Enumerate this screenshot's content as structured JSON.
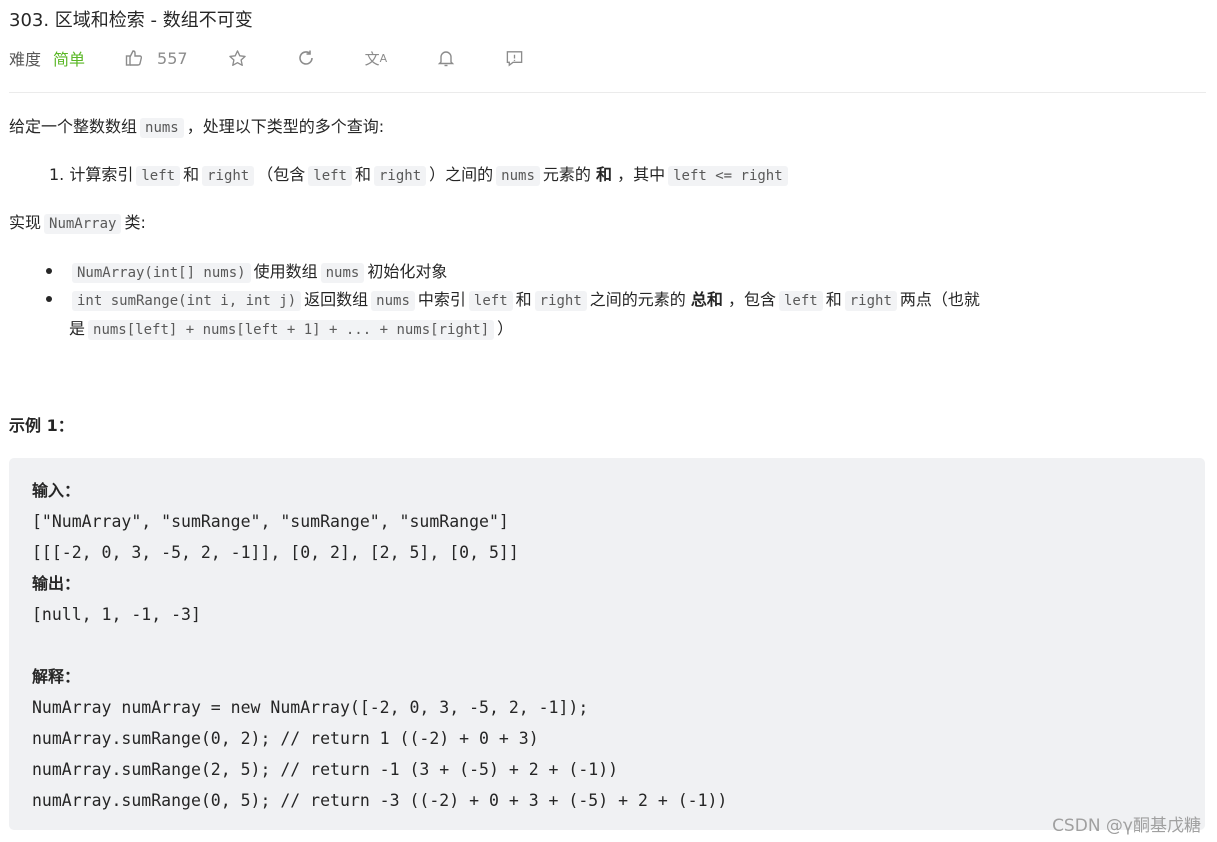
{
  "header": {
    "title": "303. 区域和检索 - 数组不可变",
    "difficulty_label": "难度",
    "difficulty": "简单",
    "likes": "557",
    "icons": [
      "thumbs-up-icon",
      "star-icon",
      "refresh-icon",
      "translate-icon",
      "bell-icon",
      "feedback-icon"
    ]
  },
  "paragraphs": [
    {
      "segs": [
        {
          "t": "给定一个整数数组"
        },
        {
          "t": "nums",
          "c": 1
        },
        {
          "t": "，处理以下类型的多个查询:"
        }
      ]
    },
    {
      "segs": [
        {
          "t": "1. 计算索引"
        },
        {
          "t": "left",
          "c": 1
        },
        {
          "t": "和"
        },
        {
          "t": "right",
          "c": 1
        },
        {
          "t": "（包含"
        },
        {
          "t": "left",
          "c": 1
        },
        {
          "t": "和"
        },
        {
          "t": "right",
          "c": 1
        },
        {
          "t": "）之间的"
        },
        {
          "t": "nums",
          "c": 1
        },
        {
          "t": "元素的 "
        },
        {
          "t": "和",
          "b": 1
        },
        {
          "t": " ，其中"
        },
        {
          "t": "left <= right",
          "c": 1
        }
      ]
    },
    {
      "segs": [
        {
          "t": "实现"
        },
        {
          "t": "NumArray",
          "c": 1
        },
        {
          "t": "类:"
        }
      ]
    },
    {
      "segs": [
        {
          "t": "NumArray(int[] nums)",
          "c": 1
        },
        {
          "t": "使用数组"
        },
        {
          "t": "nums",
          "c": 1
        },
        {
          "t": "初始化对象"
        }
      ]
    },
    {
      "segs": [
        {
          "t": "int sumRange(int i, int j)",
          "c": 1
        },
        {
          "t": "返回数组"
        },
        {
          "t": "nums",
          "c": 1
        },
        {
          "t": "中索引"
        },
        {
          "t": "left",
          "c": 1
        },
        {
          "t": "和"
        },
        {
          "t": "right",
          "c": 1
        },
        {
          "t": "之间的元素的 "
        },
        {
          "t": "总和",
          "b": 1
        },
        {
          "t": " ，包含"
        },
        {
          "t": "left",
          "c": 1
        },
        {
          "t": "和"
        },
        {
          "t": "right",
          "c": 1
        },
        {
          "t": "两点（也就"
        }
      ]
    },
    {
      "segs": [
        {
          "t": "是"
        },
        {
          "t": "nums[left] + nums[left + 1] + ... + nums[right]",
          "c": 1
        },
        {
          "t": "）"
        }
      ]
    }
  ],
  "example": {
    "heading": "示例 1：",
    "lines": [
      {
        "t": "输入：",
        "b": 1
      },
      {
        "t": "[\"NumArray\", \"sumRange\", \"sumRange\", \"sumRange\"]"
      },
      {
        "t": "[[[-2, 0, 3, -5, 2, -1]], [0, 2], [2, 5], [0, 5]]"
      },
      {
        "t": "输出：",
        "b": 1
      },
      {
        "t": "[null, 1, -1, -3]"
      },
      {
        "t": ""
      },
      {
        "t": "解释：",
        "b": 1
      },
      {
        "t": "NumArray numArray = new NumArray([-2, 0, 3, -5, 2, -1]);"
      },
      {
        "t": "numArray.sumRange(0, 2); // return 1 ((-2) + 0 + 3)"
      },
      {
        "t": "numArray.sumRange(2, 5); // return -1 (3 + (-5) + 2 + (-1))"
      },
      {
        "t": "numArray.sumRange(0, 5); // return -3 ((-2) + 0 + 3 + (-5) + 2 + (-1))"
      }
    ]
  },
  "watermark": "CSDN @γ酮基戊糖",
  "colors": {
    "easy": "#5ab726",
    "code_bg": "#f2f3f5",
    "pre_bg": "#f0f1f3"
  }
}
